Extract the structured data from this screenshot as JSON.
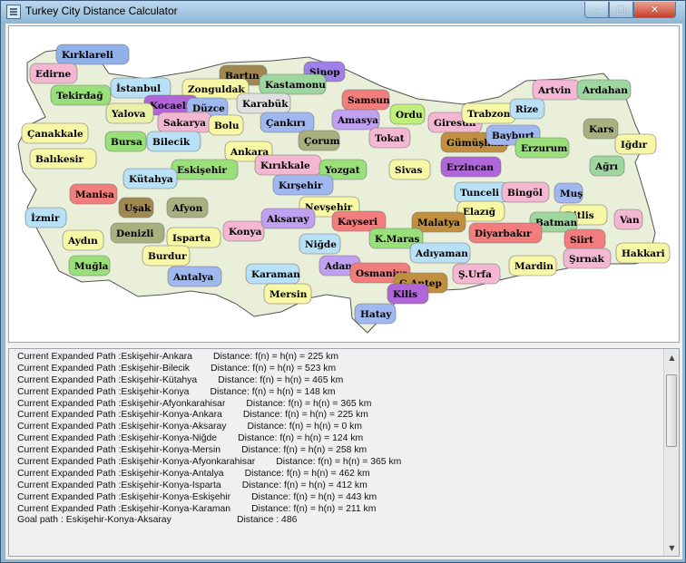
{
  "window": {
    "title": "Turkey City Distance Calculator",
    "min_glyph": "–",
    "max_glyph": "□",
    "close_glyph": "✕"
  },
  "map": {
    "cities": [
      {
        "name": "Kırklareli",
        "color": "#8fb0e8"
      },
      {
        "name": "Edirne",
        "color": "#f4b7d2"
      },
      {
        "name": "İstanbul",
        "color": "#b8e1f8"
      },
      {
        "name": "Tekirdağ",
        "color": "#9ae07a"
      },
      {
        "name": "Bartın",
        "color": "#a08850"
      },
      {
        "name": "Sinop",
        "color": "#9f7fe8"
      },
      {
        "name": "Zonguldak",
        "color": "#f7f7a6"
      },
      {
        "name": "Kastamonu",
        "color": "#9fd6a0"
      },
      {
        "name": "Samsun",
        "color": "#f27d7d"
      },
      {
        "name": "Artvin",
        "color": "#f5b7d6"
      },
      {
        "name": "Ardahan",
        "color": "#9fd6a0"
      },
      {
        "name": "Kocaeli",
        "color": "#b066d8"
      },
      {
        "name": "Düzce",
        "color": "#9fb8f0"
      },
      {
        "name": "Karabük",
        "color": "#e0e0e0"
      },
      {
        "name": "Yalova",
        "color": "#e9f0a8"
      },
      {
        "name": "Sakarya",
        "color": "#f4b7d2"
      },
      {
        "name": "Bolu",
        "color": "#f7f7a6"
      },
      {
        "name": "Çankırı",
        "color": "#9fb8f0"
      },
      {
        "name": "Amasya",
        "color": "#c0a0f0"
      },
      {
        "name": "Ordu",
        "color": "#c0f07a"
      },
      {
        "name": "Giresun",
        "color": "#f4b7d2"
      },
      {
        "name": "Trabzon",
        "color": "#f7f7a6"
      },
      {
        "name": "Rize",
        "color": "#b8e1f8"
      },
      {
        "name": "Çanakkale",
        "color": "#f7f7a6"
      },
      {
        "name": "Bursa",
        "color": "#9ae07a"
      },
      {
        "name": "Bilecik",
        "color": "#b8e1f8"
      },
      {
        "name": "Ankara",
        "color": "#f7f7a6"
      },
      {
        "name": "Çorum",
        "color": "#a8b080"
      },
      {
        "name": "Tokat",
        "color": "#f4b7d2"
      },
      {
        "name": "Gümüşhane",
        "color": "#c09040"
      },
      {
        "name": "Bayburt",
        "color": "#9fb8f0"
      },
      {
        "name": "Kars",
        "color": "#a8b080"
      },
      {
        "name": "Erzurum",
        "color": "#9ae07a"
      },
      {
        "name": "Iğdır",
        "color": "#f7f7a6"
      },
      {
        "name": "Balıkesir",
        "color": "#f7f7a6"
      },
      {
        "name": "Eskişehir",
        "color": "#9ae07a"
      },
      {
        "name": "Kırıkkale",
        "color": "#f4b7d2"
      },
      {
        "name": "Yozgat",
        "color": "#9ae07a"
      },
      {
        "name": "Sivas",
        "color": "#f7f7a6"
      },
      {
        "name": "Erzincan",
        "color": "#b066d8"
      },
      {
        "name": "Ağrı",
        "color": "#9fd6a0"
      },
      {
        "name": "Kütahya",
        "color": "#b8e1f8"
      },
      {
        "name": "Kırşehir",
        "color": "#9fb8f0"
      },
      {
        "name": "Tunceli",
        "color": "#b8e1f8"
      },
      {
        "name": "Bingöl",
        "color": "#f4b7d2"
      },
      {
        "name": "Muş",
        "color": "#9fb8f0"
      },
      {
        "name": "Manisa",
        "color": "#f27d7d"
      },
      {
        "name": "Uşak",
        "color": "#a08850"
      },
      {
        "name": "Afyon",
        "color": "#a8b080"
      },
      {
        "name": "Nevşehir",
        "color": "#f7f7a6"
      },
      {
        "name": "Elazığ",
        "color": "#f7f7a6"
      },
      {
        "name": "Bitlis",
        "color": "#f7f7a6"
      },
      {
        "name": "İzmir",
        "color": "#b8e1f8"
      },
      {
        "name": "Konya",
        "color": "#f4b7d2"
      },
      {
        "name": "Aksaray",
        "color": "#c0a0f0"
      },
      {
        "name": "Kayseri",
        "color": "#f27d7d"
      },
      {
        "name": "Malatya",
        "color": "#c09040"
      },
      {
        "name": "Batman",
        "color": "#9fd6a0"
      },
      {
        "name": "Van",
        "color": "#f4b7d2"
      },
      {
        "name": "Denizli",
        "color": "#a8b080"
      },
      {
        "name": "Isparta",
        "color": "#f7f7a6"
      },
      {
        "name": "Niğde",
        "color": "#b8e1f8"
      },
      {
        "name": "K.Maraş",
        "color": "#9ae07a"
      },
      {
        "name": "Diyarbakır",
        "color": "#f27d7d"
      },
      {
        "name": "Siirt",
        "color": "#f27d7d"
      },
      {
        "name": "Aydın",
        "color": "#f7f7a6"
      },
      {
        "name": "Adıyaman",
        "color": "#b8e1f8"
      },
      {
        "name": "Şırnak",
        "color": "#f4b7d2"
      },
      {
        "name": "Hakkari",
        "color": "#f7f7a6"
      },
      {
        "name": "Muğla",
        "color": "#9ae07a"
      },
      {
        "name": "Burdur",
        "color": "#f7f7a6"
      },
      {
        "name": "Adana",
        "color": "#c0a0f0"
      },
      {
        "name": "Mardin",
        "color": "#f7f7a6"
      },
      {
        "name": "Antalya",
        "color": "#9fb8f0"
      },
      {
        "name": "Karaman",
        "color": "#b8e1f8"
      },
      {
        "name": "Osmaniye",
        "color": "#f27d7d"
      },
      {
        "name": "Ş.Urfa",
        "color": "#f4b7d2"
      },
      {
        "name": "G.Antep",
        "color": "#c09040"
      },
      {
        "name": "Mersin",
        "color": "#f7f7a6"
      },
      {
        "name": "Kilis",
        "color": "#b066d8"
      },
      {
        "name": "Hatay",
        "color": "#9fb8f0"
      }
    ]
  },
  "log": {
    "lines": [
      "Current Expanded Path :Eskişehir-Ankara        Distance: f(n) = h(n) = 225 km",
      "Current Expanded Path :Eskişehir-Bilecik        Distance: f(n) = h(n) = 523 km",
      "Current Expanded Path :Eskişehir-Kütahya        Distance: f(n) = h(n) = 465 km",
      "Current Expanded Path :Eskişehir-Konya        Distance: f(n) = h(n) = 148 km",
      "Current Expanded Path :Eskişehir-Afyonkarahisar        Distance: f(n) = h(n) = 365 km",
      "Current Expanded Path :Eskişehir-Konya-Ankara        Distance: f(n) = h(n) = 225 km",
      "Current Expanded Path :Eskişehir-Konya-Aksaray        Distance: f(n) = h(n) = 0 km",
      "Current Expanded Path :Eskişehir-Konya-Niğde        Distance: f(n) = h(n) = 124 km",
      "Current Expanded Path :Eskişehir-Konya-Mersin        Distance: f(n) = h(n) = 258 km",
      "Current Expanded Path :Eskişehir-Konya-Afyonkarahisar        Distance: f(n) = h(n) = 365 km",
      "Current Expanded Path :Eskişehir-Konya-Antalya        Distance: f(n) = h(n) = 462 km",
      "Current Expanded Path :Eskişehir-Konya-Isparta        Distance: f(n) = h(n) = 412 km",
      "Current Expanded Path :Eskişehir-Konya-Eskişehir        Distance: f(n) = h(n) = 443 km",
      "Current Expanded Path :Eskişehir-Konya-Karaman        Distance: f(n) = h(n) = 211 km",
      "Goal path : Eskişehir-Konya-Aksaray                         Distance : 486"
    ]
  }
}
